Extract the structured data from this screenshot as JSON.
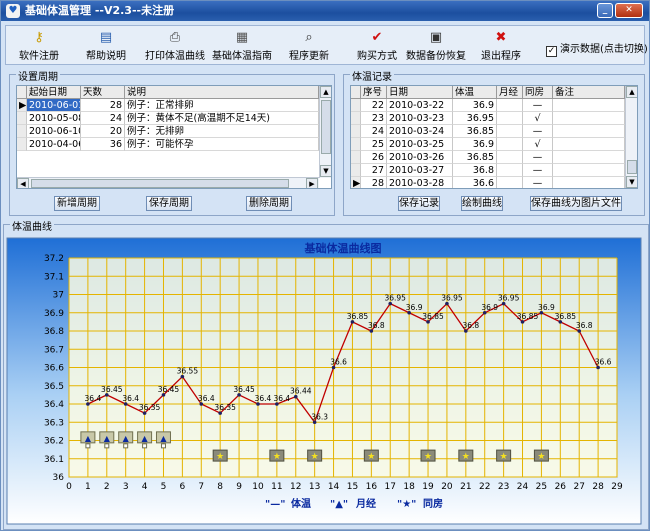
{
  "window": {
    "title": "基础体温管理 --V2.3--未注册"
  },
  "toolbar": {
    "buttons": [
      {
        "label": "软件注册",
        "icon": "key-icon",
        "color": "#c89a00"
      },
      {
        "label": "帮助说明",
        "icon": "help-book-icon",
        "color": "#2a5fae"
      },
      {
        "label": "打印体温曲线",
        "icon": "printer-icon",
        "color": "#444444"
      },
      {
        "label": "基础体温指南",
        "icon": "guide-icon",
        "color": "#555555"
      },
      {
        "label": "程序更新",
        "icon": "magnifier-icon",
        "color": "#333333"
      },
      {
        "label": "购买方式",
        "icon": "checkmark-icon",
        "color": "#d01010"
      },
      {
        "label": "数据备份恢复",
        "icon": "floppy-disk-icon",
        "color": "#333333"
      },
      {
        "label": "退出程序",
        "icon": "close-x-icon",
        "color": "#d01010"
      }
    ],
    "demo_label": "演示数据(点击切换)",
    "demo_checked": true
  },
  "period": {
    "label": "设置周期",
    "headers": [
      "起始日期",
      "天数",
      "说明"
    ],
    "rows": [
      {
        "date": "2010-06-01",
        "days": "28",
        "note": "例子：正常排卵",
        "selected": true
      },
      {
        "date": "2010-05-08",
        "days": "24",
        "note": "例子：黄体不足(高温期不足14天)"
      },
      {
        "date": "2010-06-10",
        "days": "20",
        "note": "例子：无排卵"
      },
      {
        "date": "2010-04-06",
        "days": "36",
        "note": "例子：可能怀孕"
      }
    ],
    "buttons": [
      "新增周期",
      "保存周期",
      "删除周期"
    ]
  },
  "temp": {
    "label": "体温记录",
    "headers": [
      "序号",
      "日期",
      "体温",
      "月经",
      "同房",
      "备注"
    ],
    "rows": [
      {
        "no": "22",
        "date": "2010-03-22",
        "temp": "36.9",
        "period": "",
        "sex": "—"
      },
      {
        "no": "23",
        "date": "2010-03-23",
        "temp": "36.95",
        "period": "",
        "sex": "√"
      },
      {
        "no": "24",
        "date": "2010-03-24",
        "temp": "36.85",
        "period": "",
        "sex": "—"
      },
      {
        "no": "25",
        "date": "2010-03-25",
        "temp": "36.9",
        "period": "",
        "sex": "√"
      },
      {
        "no": "26",
        "date": "2010-03-26",
        "temp": "36.85",
        "period": "",
        "sex": "—"
      },
      {
        "no": "27",
        "date": "2010-03-27",
        "temp": "36.8",
        "period": "",
        "sex": "—"
      },
      {
        "no": "28",
        "date": "2010-03-28",
        "temp": "36.6",
        "period": "",
        "sex": "—",
        "selected": true
      }
    ],
    "buttons": [
      "保存记录",
      "绘制曲线",
      "保存曲线为图片文件"
    ]
  },
  "curve": {
    "label": "体温曲线"
  },
  "chart_data": {
    "type": "line",
    "title": "基础体温曲线图",
    "xlim": [
      0,
      29
    ],
    "ylim": [
      36,
      37.2
    ],
    "x_ticks": [
      0,
      1,
      2,
      3,
      4,
      5,
      6,
      7,
      8,
      9,
      10,
      11,
      12,
      13,
      14,
      15,
      16,
      17,
      18,
      19,
      20,
      21,
      22,
      23,
      24,
      25,
      26,
      27,
      28,
      29
    ],
    "y_ticks": [
      "36",
      "36.1",
      "36.2",
      "36.3",
      "36.4",
      "36.5",
      "36.6",
      "36.7",
      "36.8",
      "36.9",
      "37",
      "37.1",
      "37.2"
    ],
    "grid": true,
    "series": [
      {
        "name": "体温",
        "x": [
          1,
          2,
          3,
          4,
          5,
          6,
          7,
          8,
          9,
          10,
          11,
          12,
          13,
          14,
          15,
          16,
          17,
          18,
          19,
          20,
          21,
          22,
          23,
          24,
          25,
          26,
          27,
          28
        ],
        "values": [
          36.4,
          36.45,
          36.4,
          36.35,
          36.45,
          36.55,
          36.4,
          36.35,
          36.45,
          36.4,
          36.4,
          36.44,
          36.3,
          36.6,
          36.85,
          36.8,
          36.95,
          36.9,
          36.85,
          36.95,
          36.8,
          36.9,
          36.95,
          36.85,
          36.9,
          36.85,
          36.8,
          36.6
        ],
        "labels": [
          "36.4",
          "36.45",
          "36.4",
          "36.35",
          "36.45",
          "36.55",
          "36.4",
          "36.35",
          "36.45",
          "36.4",
          "36.4",
          "36.44",
          "36.3",
          "36.6",
          "36.85",
          "36.8",
          "36.95",
          "36.9",
          "36.85",
          "36.95",
          "36.8",
          "36.9",
          "36.95",
          "36.85",
          "36.9",
          "36.85",
          "36.8",
          "36.6"
        ],
        "color": "#c00000"
      }
    ],
    "period_days": [
      1,
      2,
      3,
      4,
      5
    ],
    "intercourse_days": [
      8,
      11,
      13,
      16,
      19,
      21,
      23,
      25
    ],
    "legend": [
      {
        "sym": "\"—\"",
        "text": "体温"
      },
      {
        "sym": "\"▲\"",
        "text": "月经"
      },
      {
        "sym": "\"★\"",
        "text": "同房"
      }
    ],
    "legend_position": "bottom"
  }
}
